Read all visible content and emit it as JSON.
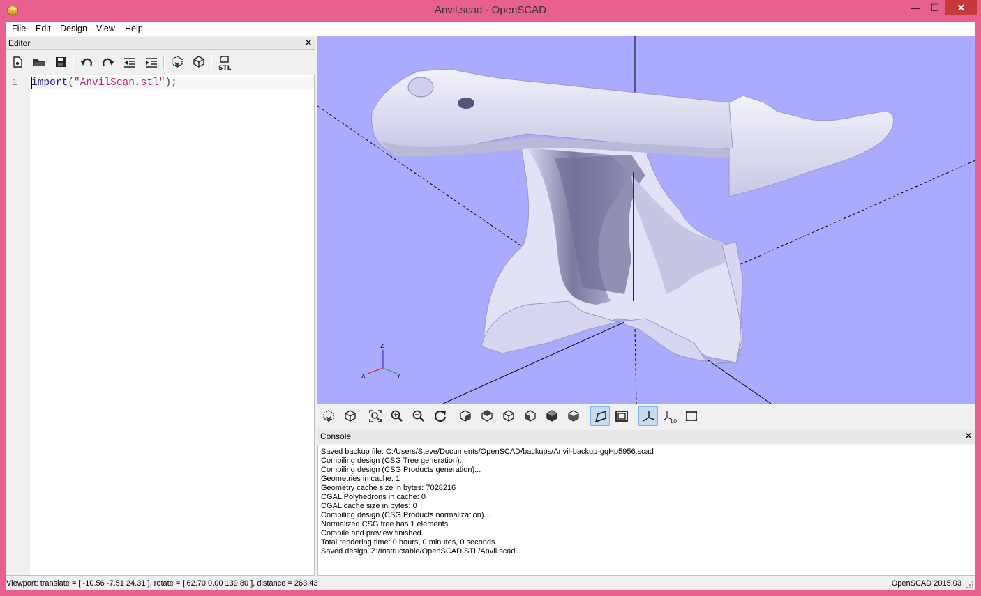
{
  "window": {
    "title": "Anvil.scad - OpenSCAD",
    "minimize": "—",
    "maximize": "☐",
    "close": "✕"
  },
  "menu": {
    "items": [
      "File",
      "Edit",
      "Design",
      "View",
      "Help"
    ]
  },
  "editor": {
    "title": "Editor",
    "close": "✕",
    "line_number": "1",
    "code": {
      "keyword": "import",
      "open": "(",
      "string": "\"AnvilScan.stl\"",
      "close": ");"
    },
    "toolbar_icons": [
      "new-file-icon",
      "open-folder-icon",
      "save-icon",
      "undo-icon",
      "redo-icon",
      "unindent-icon",
      "indent-icon",
      "preview-icon",
      "render-icon",
      "export-stl-icon"
    ],
    "stl_label": "STL"
  },
  "viewport": {
    "background": "#aaaaff",
    "model_color": "#dcdcf5",
    "axis_labels": {
      "z": "Z",
      "x": "X",
      "y": "Y"
    },
    "toolbar_icons": [
      "preview-icon",
      "render-icon",
      "view-all-icon",
      "zoom-in-icon",
      "zoom-out-icon",
      "reset-view-icon",
      "view-right-icon",
      "view-top-icon",
      "view-bottom-icon",
      "view-left-icon",
      "view-front-icon",
      "view-back-icon",
      "perspective-icon",
      "orthogonal-icon",
      "show-axes-icon",
      "show-scale-icon",
      "show-edges-icon"
    ],
    "active_toolbar": [
      "perspective-icon",
      "show-axes-icon"
    ],
    "scale_label": "10"
  },
  "console": {
    "title": "Console",
    "close": "✕",
    "lines": [
      "Saved backup file: C:/Users/Steve/Documents/OpenSCAD/backups/Anvil-backup-gqHp5956.scad",
      "Compiling design (CSG Tree generation)...",
      "Compiling design (CSG Products generation)...",
      "Geometries in cache: 1",
      "Geometry cache size in bytes: 7028216",
      "CGAL Polyhedrons in cache: 0",
      "CGAL cache size in bytes: 0",
      "Compiling design (CSG Products normalization)...",
      "Normalized CSG tree has 1 elements",
      "Compile and preview finished.",
      "Total rendering time: 0 hours, 0 minutes, 0 seconds",
      "Saved design 'Z:/Instructable/OpenSCAD STL/Anvil.scad'."
    ]
  },
  "status": {
    "viewport": "Viewport: translate = [ -10.56 -7.51 24.31 ], rotate = [ 62.70 0.00 139.80 ], distance = 263.43",
    "version": "OpenSCAD 2015.03"
  }
}
